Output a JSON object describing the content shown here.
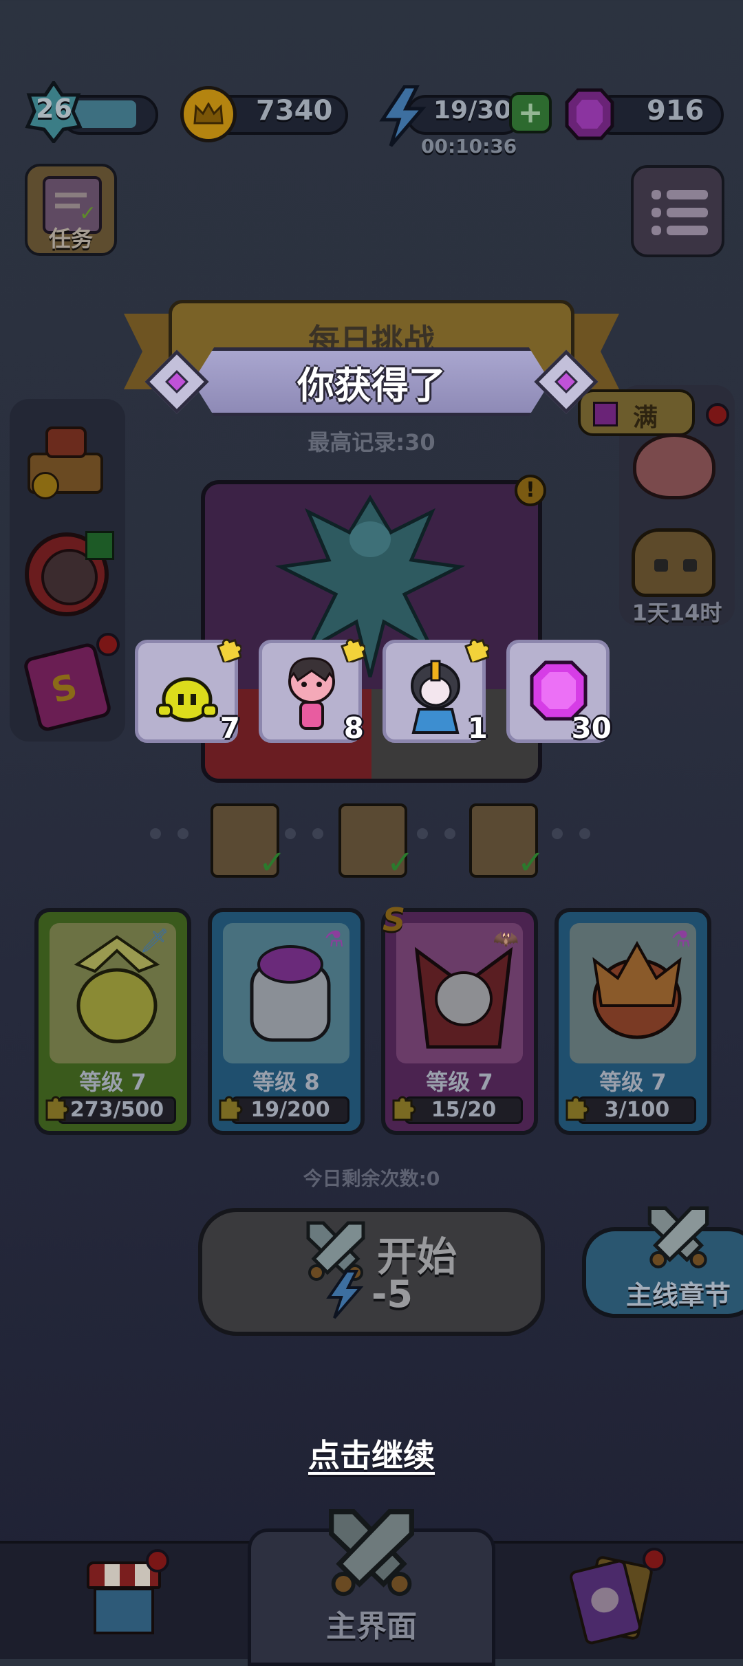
{
  "hud": {
    "player_level": "26",
    "gold": "7340",
    "energy": "19/30",
    "energy_timer": "00:10:36",
    "gems": "916"
  },
  "buttons": {
    "tasks_label": "任务",
    "menu_icon": "list-menu-icon"
  },
  "daily_challenge": {
    "title": "每日挑战",
    "best_record": "最高记录:30"
  },
  "right_side": {
    "piggy_full_label": "满",
    "event_timer": "1天14时"
  },
  "reward_popup": {
    "title": "你获得了",
    "items": [
      {
        "icon": "yellow-cactus-hero-icon",
        "count": "7",
        "bg": "#b7b2cf"
      },
      {
        "icon": "pink-girl-hero-icon",
        "count": "8",
        "bg": "#b7b2cf"
      },
      {
        "icon": "knight-girl-hero-icon",
        "count": "1",
        "bg": "#b7b2cf"
      },
      {
        "icon": "purple-gem-icon",
        "count": "30",
        "bg": "#b7b2cf"
      }
    ],
    "continue_label": "点击继续"
  },
  "heroes": [
    {
      "name_icon": "golden-bird-hero-icon",
      "level": "等级 7",
      "progress": "273/500",
      "frame": "#3a5a1c",
      "portrait": "#6c7244",
      "lvl_bg": "#2b4a1e",
      "badge": "sword-icon"
    },
    {
      "name_icon": "robot-hero-icon",
      "level": "等级 8",
      "progress": "19/200",
      "frame": "#1f4f6e",
      "portrait": "#48707e",
      "lvl_bg": "#1d4258",
      "badge": "potion-icon"
    },
    {
      "name_icon": "vampire-hero-icon",
      "level": "等级 7",
      "progress": "15/20",
      "frame": "#4b2350",
      "portrait": "#6a3c68",
      "lvl_bg": "#3e2045",
      "badge": "bat-icon",
      "rank": "S"
    },
    {
      "name_icon": "dragon-warrior-hero-icon",
      "level": "等级 7",
      "progress": "3/100",
      "frame": "#1f4f6e",
      "portrait": "#5c6e70",
      "lvl_bg": "#1d4258",
      "badge": "potion-icon"
    }
  ],
  "start": {
    "remaining": "今日剩余次数:0",
    "label": "开始",
    "cost": "-5"
  },
  "chapter_button": "主线章节",
  "bottom_nav": {
    "home_label": "主界面"
  },
  "colors": {
    "accent_gold": "#b48410",
    "reward_card": "#b7b2cf",
    "gem_purple": "#d63de6"
  }
}
